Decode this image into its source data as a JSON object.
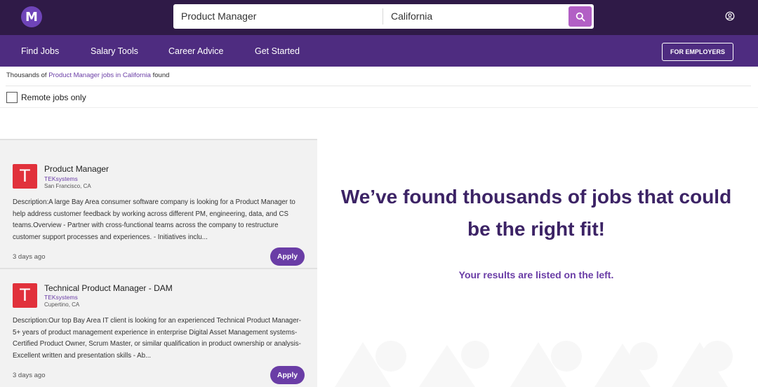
{
  "header": {
    "logo_letter": "M",
    "search_what": "Product Manager",
    "search_where": "California",
    "search_icon": "search-icon",
    "account_icon": "user-circle-icon"
  },
  "nav": {
    "items": [
      {
        "label": "Find Jobs"
      },
      {
        "label": "Salary Tools"
      },
      {
        "label": "Career Advice"
      },
      {
        "label": "Get Started"
      }
    ],
    "employers_label": "FOR EMPLOYERS"
  },
  "results": {
    "prefix": "Thousands of ",
    "keyword": "Product Manager jobs in California",
    "suffix": " found"
  },
  "filters": {
    "remote_label": "Remote jobs only",
    "remote_checked": false
  },
  "jobs": [
    {
      "logo_letter": "T",
      "title": "Product Manager",
      "company": "TEKsystems",
      "location": "San Francisco, CA",
      "description": "Description:A large Bay Area consumer software company is looking for a Product Manager to help address customer feedback by working across different PM, engineering, data, and CS teams.Overview - Partner with cross-functional teams across the company to restructure customer support processes and experiences. - Initiatives inclu...",
      "age": "3 days ago",
      "apply_label": "Apply"
    },
    {
      "logo_letter": "T",
      "title": "Technical Product Manager - DAM",
      "company": "TEKsystems",
      "location": "Cupertino, CA",
      "description": "Description:Our top Bay Area IT client is looking for an experienced Technical Product Manager- 5+ years of product management experience in enterprise Digital Asset Management systems- Certified Product Owner, Scrum Master, or similar qualification in product ownership or analysis- Excellent written and presentation skills - Ab...",
      "age": "3 days ago",
      "apply_label": "Apply"
    }
  ],
  "panel": {
    "headline": "We’ve found thousands of jobs that could be the right fit!",
    "subtext": "Your results are listed on the left."
  },
  "colors": {
    "topbar": "#2f1a47",
    "navbar": "#4e2c80",
    "accent": "#6a3da6",
    "search_button": "#b25fc5",
    "company_logo": "#e1313b"
  }
}
